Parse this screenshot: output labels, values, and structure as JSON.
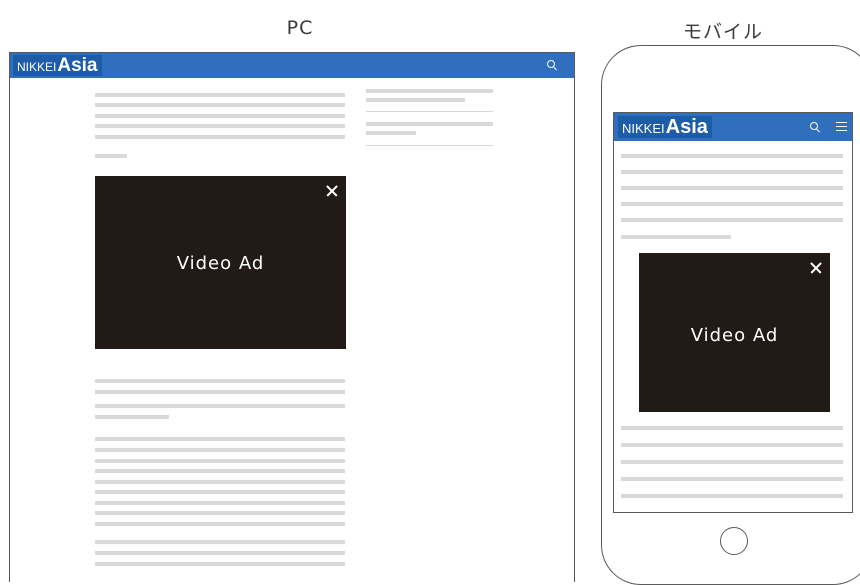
{
  "labels": {
    "pc": "PC",
    "mobile": "モバイル"
  },
  "pc": {
    "logo_nikkei": "NIKKEI",
    "logo_asia": "Asia",
    "video_ad_label": "Video Ad"
  },
  "mobile": {
    "logo_nikkei": "NIKKEI",
    "logo_asia": "Asia",
    "video_ad_label": "Video Ad"
  },
  "icons": {
    "search": "search-icon",
    "close": "close-icon",
    "menu": "hamburger-menu-icon",
    "home": "home-button"
  },
  "colors": {
    "header": "#2f6fbd",
    "logo_bg": "#1e5ca8",
    "video_bg": "#221a16",
    "placeholder_line": "#d9d9d9"
  }
}
